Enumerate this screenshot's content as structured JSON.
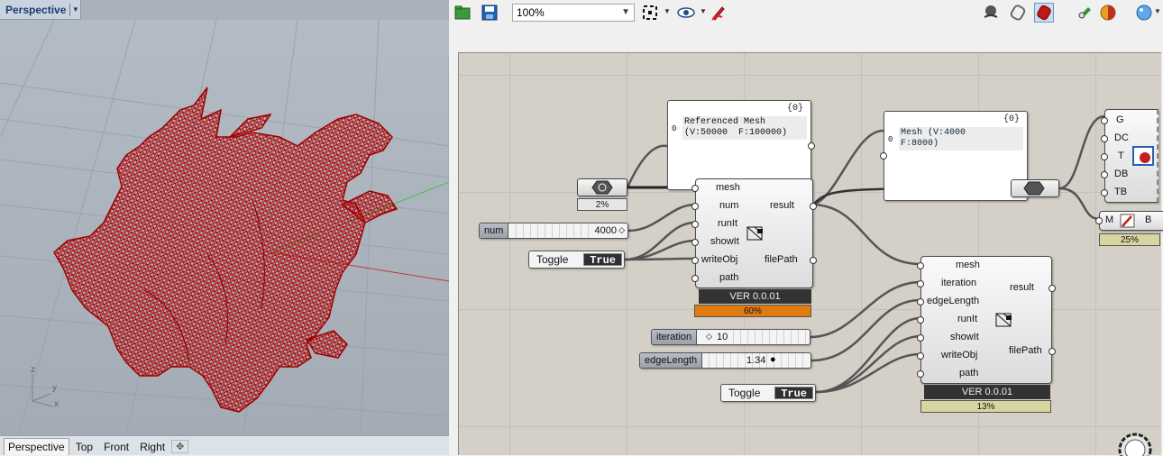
{
  "rhino": {
    "viewport_title": "Perspective",
    "axes": {
      "z": "z",
      "y": "y",
      "x": "x"
    },
    "tabs": [
      {
        "label": "Perspective",
        "active": true
      },
      {
        "label": "Top",
        "active": false
      },
      {
        "label": "Front",
        "active": false
      },
      {
        "label": "Right",
        "active": false
      }
    ],
    "add_tab": "✥"
  },
  "toolbar": {
    "zoom_value": "100%"
  },
  "grasshopper": {
    "panel_input": {
      "count": "{0}",
      "index": "0",
      "text": "Referenced Mesh\n(V:50000  F:100000)"
    },
    "panel_output": {
      "count": "{0}",
      "index": "0",
      "text": "Mesh (V:4000\nF:8000)"
    },
    "mesh_param": {
      "progress": "2%"
    },
    "mesh_param_2": {},
    "comp1": {
      "inputs": [
        "mesh",
        "num",
        "runIt",
        "showIt",
        "writeObj",
        "path"
      ],
      "outputs": [
        "result",
        "filePath"
      ],
      "version": "VER 0.0.01",
      "progress": "60%",
      "progress_color": "#e07b12"
    },
    "comp2": {
      "inputs": [
        "mesh",
        "iteration",
        "edgeLength",
        "runIt",
        "showIt",
        "writeObj",
        "path"
      ],
      "outputs": [
        "result",
        "filePath"
      ],
      "version": "VER 0.0.01",
      "progress": "13%",
      "progress_color": "#d8d6a0"
    },
    "slider_num": {
      "label": "num",
      "value": "4000"
    },
    "slider_iteration": {
      "label": "iteration",
      "value": "10"
    },
    "slider_edge": {
      "label": "edgeLength",
      "value": "1.34"
    },
    "toggle1": {
      "label": "Toggle",
      "value": "True"
    },
    "toggle2": {
      "label": "Toggle",
      "value": "True"
    },
    "deconstruct": {
      "outputs": [
        "G",
        "DC",
        "T",
        "DB",
        "TB"
      ]
    },
    "preview": {
      "in": "M",
      "out": "B",
      "progress": "25%",
      "progress_color": "#d8d6a0"
    }
  }
}
